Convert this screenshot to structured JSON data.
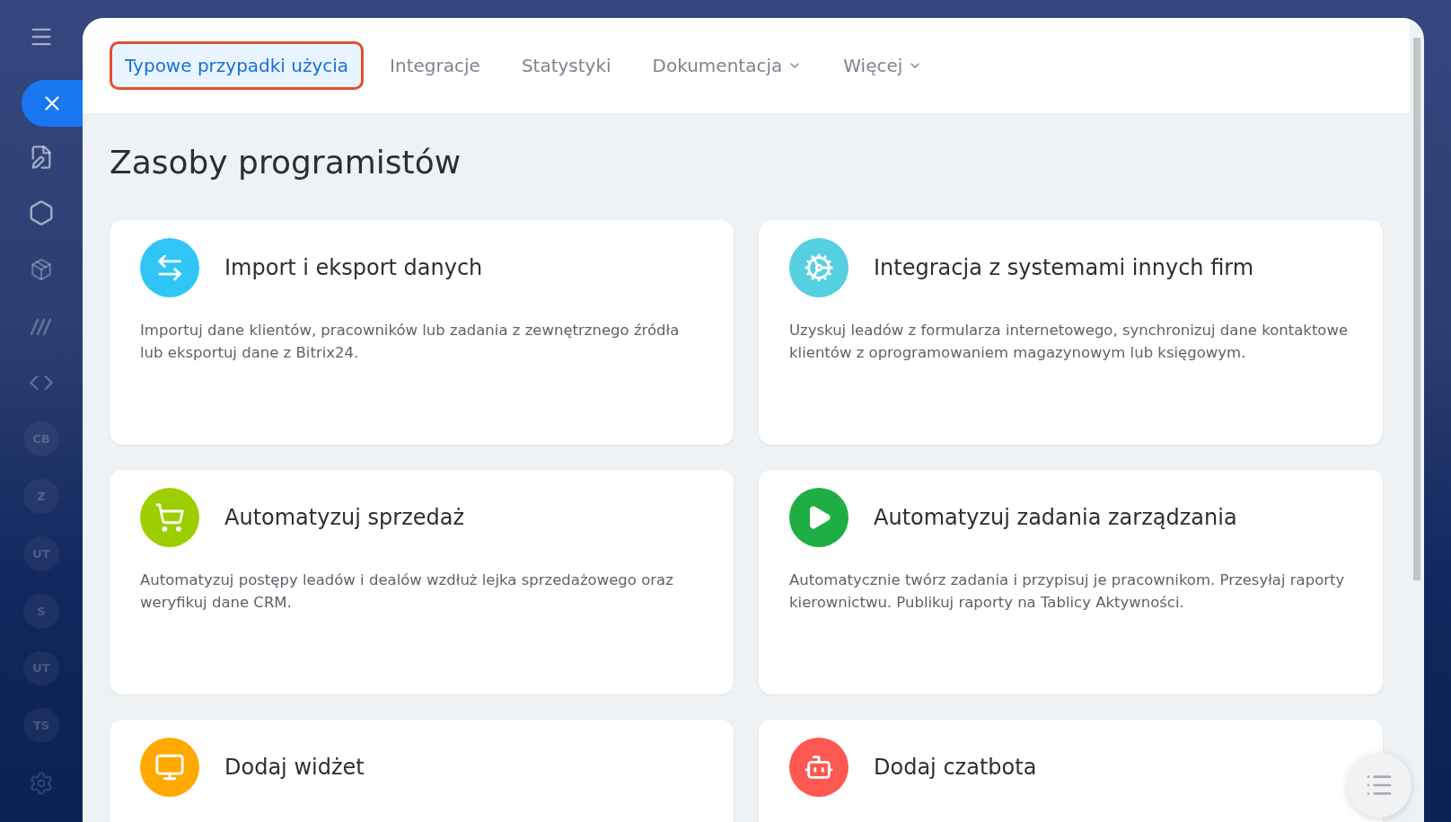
{
  "sidebar": {
    "avatars": [
      {
        "initials": "CB"
      },
      {
        "initials": "Z"
      },
      {
        "initials": "UT"
      },
      {
        "initials": "S"
      },
      {
        "initials": "UT"
      },
      {
        "initials": "TS"
      }
    ]
  },
  "tabs": [
    {
      "label": "Typowe przypadki użycia",
      "selected": true,
      "dropdown": false
    },
    {
      "label": "Integracje",
      "selected": false,
      "dropdown": false
    },
    {
      "label": "Statystyki",
      "selected": false,
      "dropdown": false
    },
    {
      "label": "Dokumentacja",
      "selected": false,
      "dropdown": true
    },
    {
      "label": "Więcej",
      "selected": false,
      "dropdown": true
    }
  ],
  "heading": "Zasoby programistów",
  "cards": [
    {
      "kind": "exchange",
      "color": "#2fc6f6",
      "title": "Import i eksport danych",
      "description": "Importuj dane klientów, pracowników lub zadania z zewnętrznego źródła lub eksportuj dane z Bitrix24."
    },
    {
      "kind": "gears",
      "color": "#55d0e0",
      "title": "Integracja z systemami innych firm",
      "description": "Uzyskuj leadów z formularza internetowego, synchronizuj dane kontaktowe klientów z oprogramowaniem magazynowym lub księgowym."
    },
    {
      "kind": "cart",
      "color": "#9dcf00",
      "title": "Automatyzuj sprzedaż",
      "description": "Automatyzuj postępy leadów i dealów wzdłuż lejka sprzedażowego oraz weryfikuj dane CRM."
    },
    {
      "kind": "play",
      "color": "#1eae43",
      "title": "Automatyzuj zadania zarządzania",
      "description": "Automatycznie twórz zadania i przypisuj je pracownikom. Przesyłaj raporty kierownictwu. Publikuj raporty na Tablicy Aktywności."
    },
    {
      "kind": "widget",
      "color": "#ffa900",
      "title": "Dodaj widżet"
    },
    {
      "kind": "bot",
      "color": "#ff5752",
      "title": "Dodaj czatbota"
    }
  ]
}
